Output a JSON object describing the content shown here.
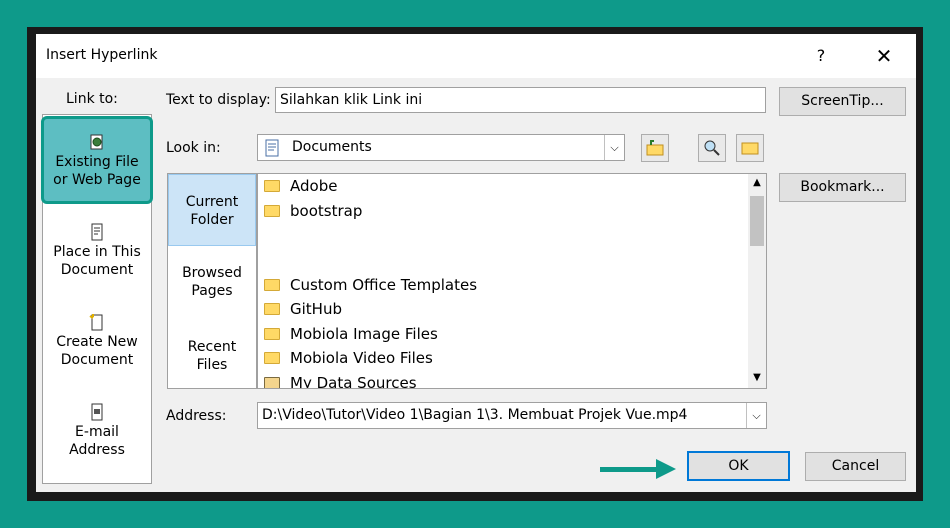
{
  "dialog": {
    "title": "Insert Hyperlink",
    "help": "?",
    "close": "✕"
  },
  "link_to": {
    "label": "Link to:",
    "items": [
      {
        "line1": "Existing File",
        "line2": "or Web Page",
        "icon": "existing-file-icon",
        "selected": true
      },
      {
        "line1": "Place in This",
        "line2": "Document",
        "icon": "place-in-document-icon"
      },
      {
        "line1": "Create New",
        "line2": "Document",
        "icon": "new-document-icon"
      },
      {
        "line1": "E-mail",
        "line2": "Address",
        "icon": "email-icon"
      }
    ]
  },
  "text_to_display": {
    "label": "Text to display:",
    "value": "Silahkan klik Link ini"
  },
  "screentip_button": "ScreenTip...",
  "look_in": {
    "label": "Look in:",
    "value": "Documents"
  },
  "bookmark_button": "Bookmark...",
  "nav": [
    {
      "line1": "Current",
      "line2": "Folder",
      "selected": true
    },
    {
      "line1": "Browsed",
      "line2": "Pages"
    },
    {
      "line1": "Recent",
      "line2": "Files"
    }
  ],
  "files": [
    {
      "name": "Adobe"
    },
    {
      "name": "bootstrap"
    },
    {
      "name": ""
    },
    {
      "name": ""
    },
    {
      "name": "Custom Office Templates"
    },
    {
      "name": "GitHub"
    },
    {
      "name": "Mobiola Image Files"
    },
    {
      "name": "Mobiola Video Files"
    },
    {
      "name": "My Data Sources"
    }
  ],
  "address": {
    "label": "Address:",
    "value": "D:\\Video\\Tutor\\Video 1\\Bagian 1\\3. Membuat Projek Vue.mp4"
  },
  "ok_button": "OK",
  "cancel_button": "Cancel",
  "colors": {
    "accent": "#0e9a8a",
    "selected_link": "#5dbec2",
    "nav_selected": "#cce4f7",
    "folder": "#ffd966"
  }
}
